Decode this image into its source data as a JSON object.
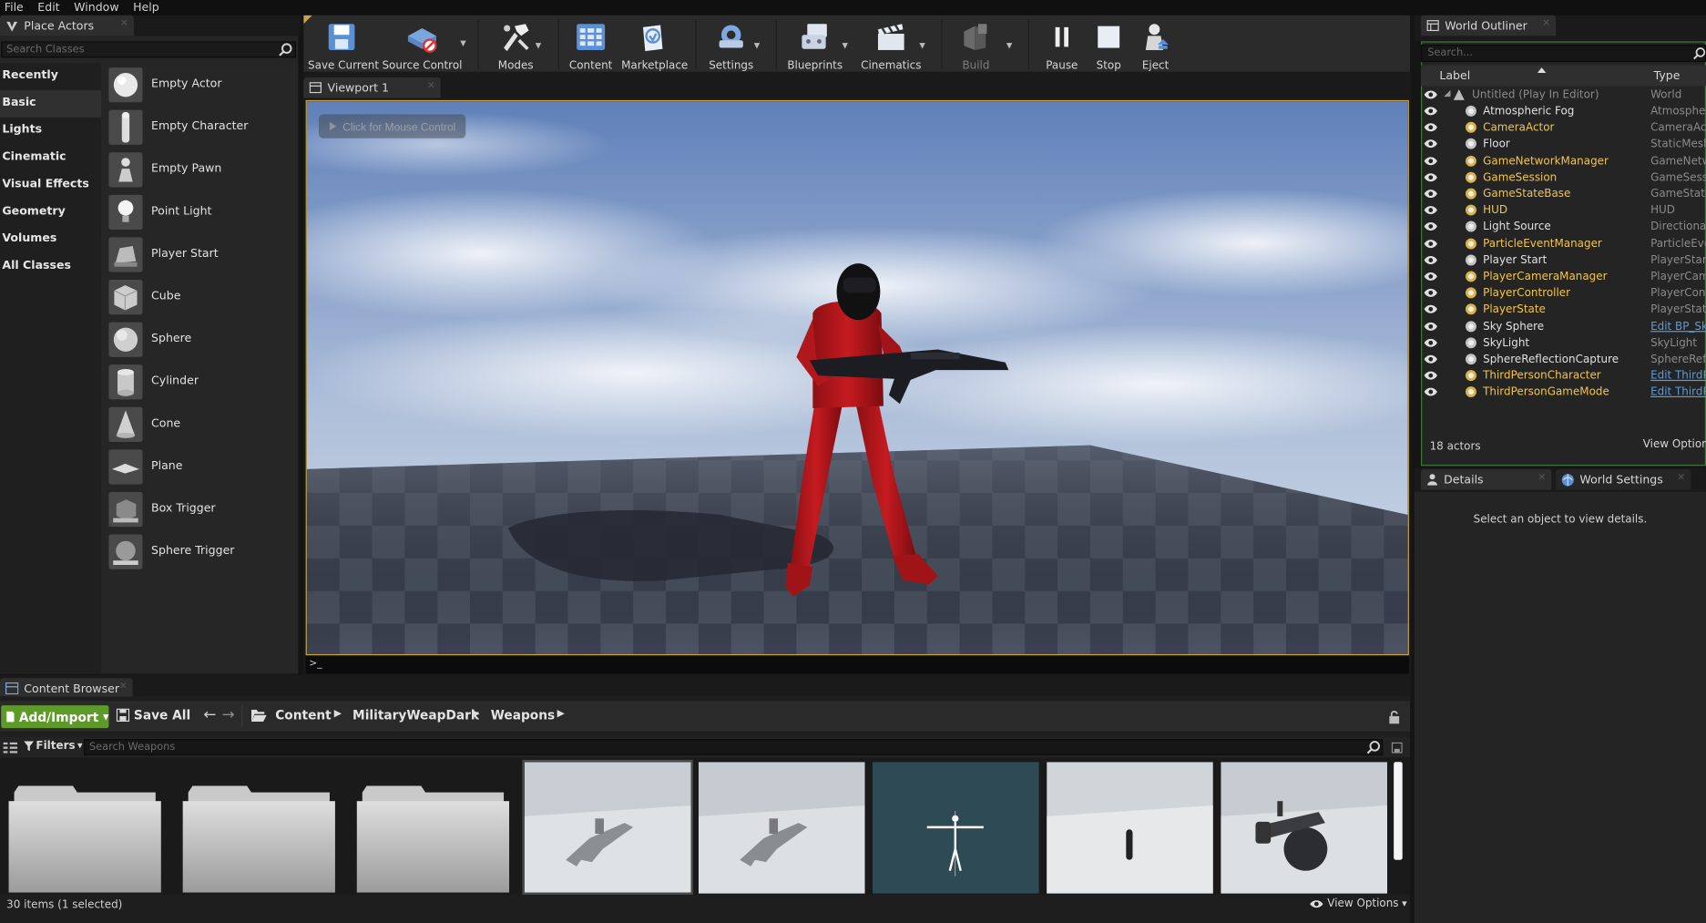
{
  "menu": [
    "File",
    "Edit",
    "Window",
    "Help"
  ],
  "place_actors": {
    "tab_title": "Place Actors",
    "search_placeholder": "Search Classes",
    "categories": [
      "Recently Placed",
      "Basic",
      "Lights",
      "Cinematic",
      "Visual Effects",
      "Geometry",
      "Volumes",
      "All Classes"
    ],
    "selected_category": "Basic",
    "actors": [
      "Empty Actor",
      "Empty Character",
      "Empty Pawn",
      "Point Light",
      "Player Start",
      "Cube",
      "Sphere",
      "Cylinder",
      "Cone",
      "Plane",
      "Box Trigger",
      "Sphere Trigger"
    ]
  },
  "toolbar": {
    "save_current": "Save Current",
    "source_control": "Source Control",
    "modes": "Modes",
    "content": "Content",
    "marketplace": "Marketplace",
    "settings": "Settings",
    "blueprints": "Blueprints",
    "cinematics": "Cinematics",
    "build": "Build",
    "pause": "Pause",
    "stop": "Stop",
    "eject": "Eject"
  },
  "viewport": {
    "tab_title": "Viewport 1",
    "mouse_hint": "Click for Mouse Control",
    "console_prompt": ">_"
  },
  "outliner": {
    "tab_title": "World Outliner",
    "search_placeholder": "Search...",
    "col_label": "Label",
    "col_type": "Type",
    "world": {
      "label": "Untitled (Play In Editor)",
      "type": "World"
    },
    "rows": [
      {
        "label": "Atmospheric Fog",
        "type": "AtmosphericFog",
        "gold": false,
        "link": false
      },
      {
        "label": "CameraActor",
        "type": "CameraActor",
        "gold": true,
        "link": false
      },
      {
        "label": "Floor",
        "type": "StaticMeshActor",
        "gold": false,
        "link": false
      },
      {
        "label": "GameNetworkManager",
        "type": "GameNetworkManager",
        "gold": true,
        "link": false
      },
      {
        "label": "GameSession",
        "type": "GameSession",
        "gold": true,
        "link": false
      },
      {
        "label": "GameStateBase",
        "type": "GameStateBase",
        "gold": true,
        "link": false
      },
      {
        "label": "HUD",
        "type": "HUD",
        "gold": true,
        "link": false
      },
      {
        "label": "Light Source",
        "type": "DirectionalLight",
        "gold": false,
        "link": false
      },
      {
        "label": "ParticleEventManager",
        "type": "ParticleEventManager",
        "gold": true,
        "link": false
      },
      {
        "label": "Player Start",
        "type": "PlayerStart",
        "gold": false,
        "link": false
      },
      {
        "label": "PlayerCameraManager",
        "type": "PlayerCameraManager",
        "gold": true,
        "link": false
      },
      {
        "label": "PlayerController",
        "type": "PlayerController",
        "gold": true,
        "link": false
      },
      {
        "label": "PlayerState",
        "type": "PlayerState",
        "gold": true,
        "link": false
      },
      {
        "label": "Sky Sphere",
        "type": "Edit BP_Sky_Sphere",
        "gold": false,
        "link": true
      },
      {
        "label": "SkyLight",
        "type": "SkyLight",
        "gold": false,
        "link": false
      },
      {
        "label": "SphereReflectionCapture",
        "type": "SphereReflectionCapture",
        "gold": false,
        "link": false
      },
      {
        "label": "ThirdPersonCharacter",
        "type": "Edit ThirdPersonCharacter",
        "gold": true,
        "link": true
      },
      {
        "label": "ThirdPersonGameMode",
        "type": "Edit ThirdPersonGameMode",
        "gold": true,
        "link": true
      }
    ],
    "actor_count": "18 actors",
    "view_options": "View Options"
  },
  "details": {
    "tab_title": "Details",
    "world_settings_tab": "World Settings",
    "empty_message": "Select an object to view details."
  },
  "content_browser": {
    "tab_title": "Content Browser",
    "add_import": "Add/Import",
    "save_all": "Save All",
    "breadcrumbs": [
      "Content",
      "MilitaryWeapDark",
      "Weapons"
    ],
    "filters": "Filters",
    "search_placeholder": "Search Weapons",
    "status": "30 items (1 selected)",
    "view_options": "View Options"
  },
  "colors": {
    "accent_gold": "#f0c44c",
    "link_blue": "#5a9bdc",
    "add_import_green": "#6aa12f",
    "character_red": "#b4181c"
  }
}
